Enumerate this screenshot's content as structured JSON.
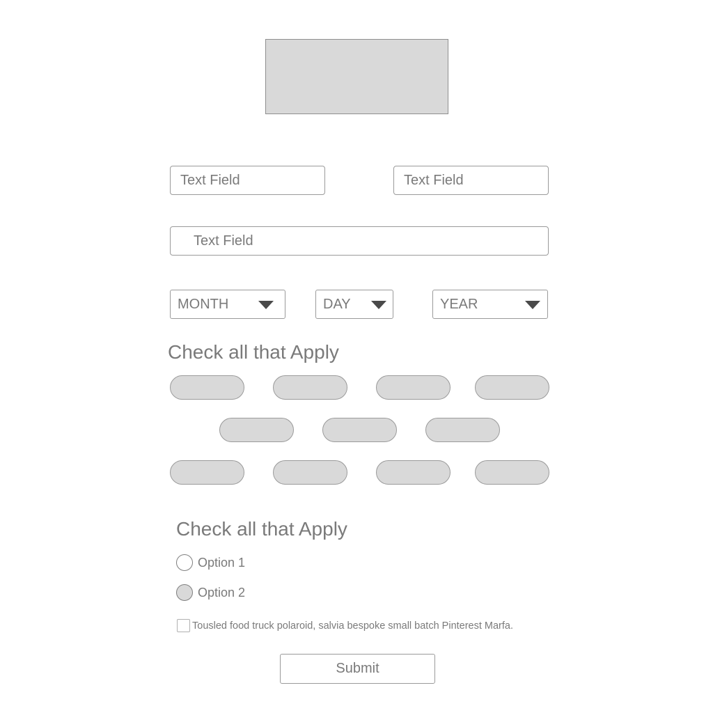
{
  "form": {
    "text_field_1": {
      "placeholder": "Text Field"
    },
    "text_field_2": {
      "placeholder": "Text Field"
    },
    "text_field_3": {
      "placeholder": "Text Field"
    },
    "selects": {
      "month": "MONTH",
      "day": "DAY",
      "year": "YEAR"
    },
    "section_1": {
      "heading": "Check all that Apply"
    },
    "section_2": {
      "heading": "Check all that Apply",
      "options": [
        {
          "label": "Option 1",
          "selected": false
        },
        {
          "label": "Option 2",
          "selected": true
        }
      ]
    },
    "checkbox_label": "Tousled food truck polaroid, salvia bespoke small batch Pinterest Marfa.",
    "submit_label": "Submit"
  },
  "colors": {
    "placeholder_fill": "#d9d9d9",
    "border": "#9a9a9a",
    "text": "#7a7a7a",
    "caret": "#4a4a4a"
  }
}
